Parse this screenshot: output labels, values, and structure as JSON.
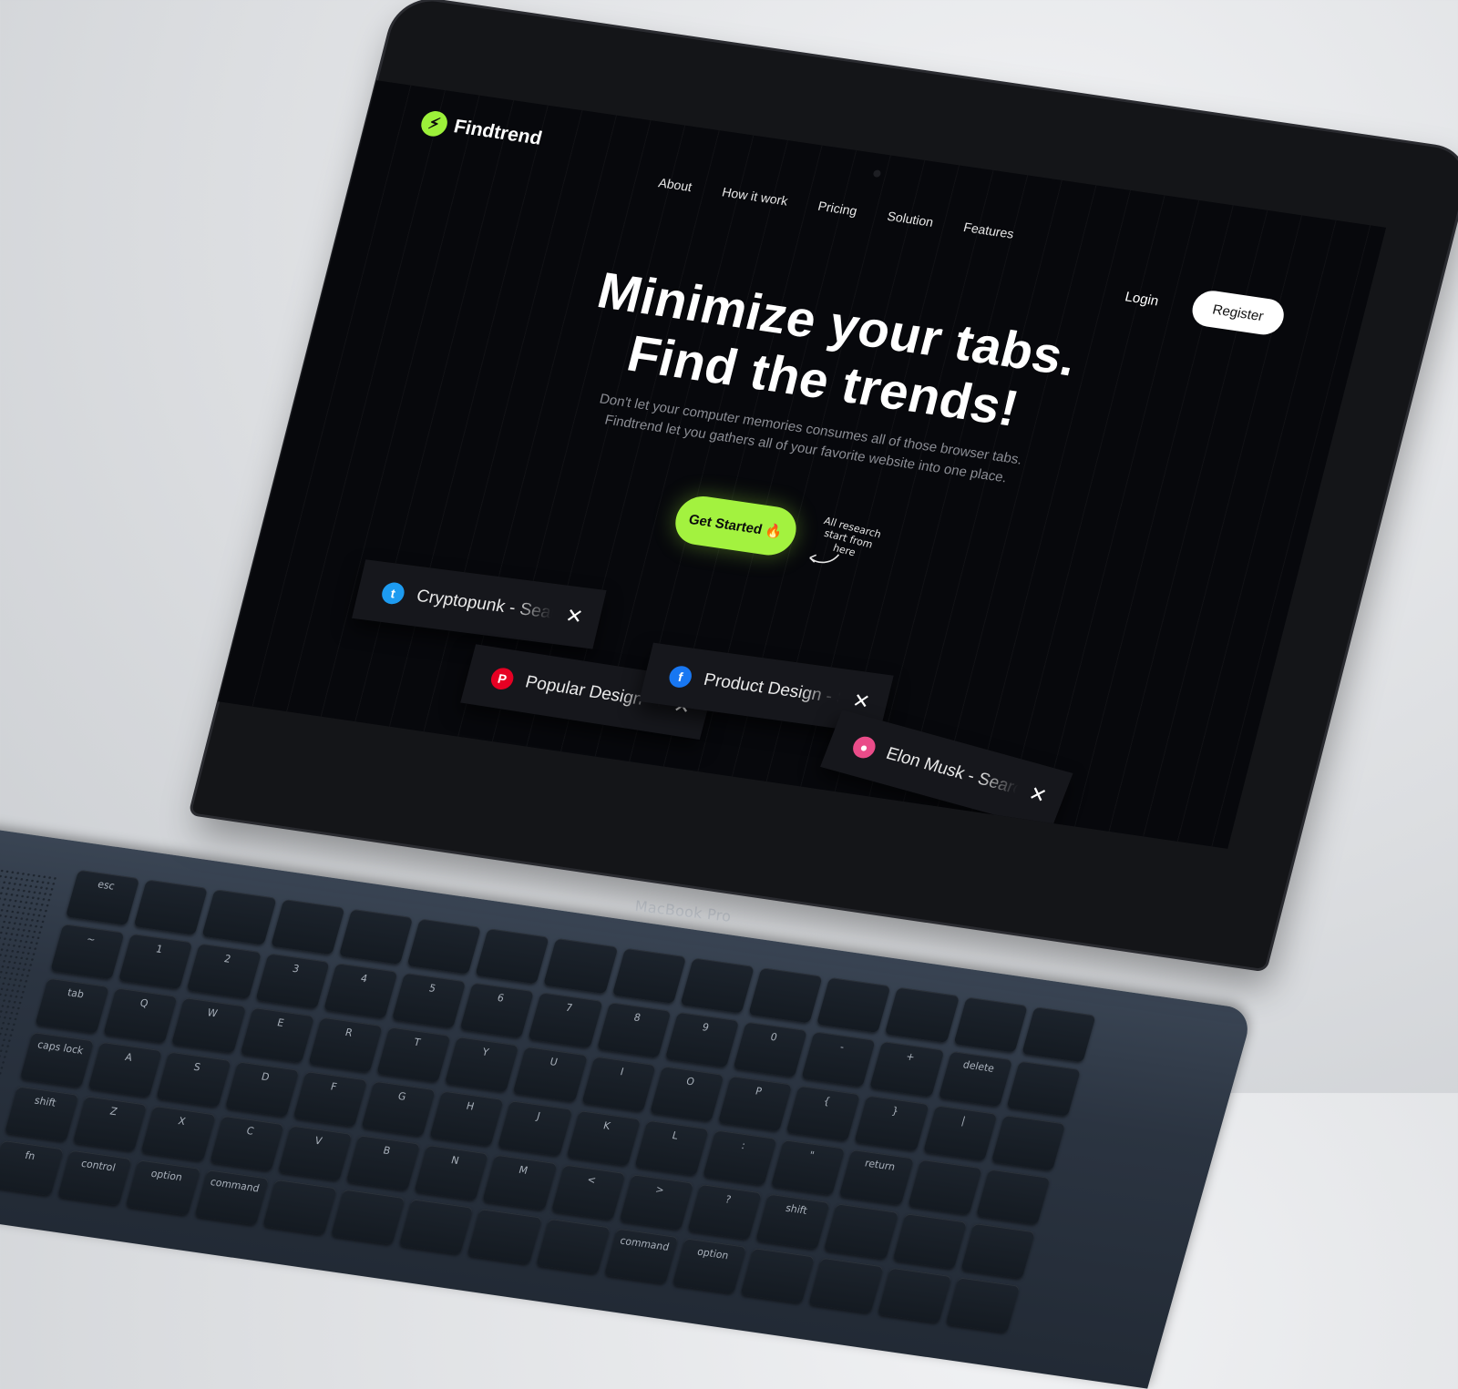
{
  "brand": {
    "name": "Findtrend",
    "logo_icon": "bolt-icon",
    "accent": "#9cf03a"
  },
  "nav": {
    "items": [
      {
        "label": "About"
      },
      {
        "label": "How it work"
      },
      {
        "label": "Pricing"
      },
      {
        "label": "Solution"
      },
      {
        "label": "Features"
      }
    ],
    "login_label": "Login",
    "register_label": "Register"
  },
  "hero": {
    "title_line1": "Minimize your tabs.",
    "title_line2": "Find the trends!",
    "subtitle_line1": "Don't let your computer memories consumes all of those browser tabs.",
    "subtitle_line2": "Findtrend  let you gathers all of your favorite website into one place.",
    "cta_label": "Get Started",
    "cta_emoji": "🔥",
    "hint_line1": "All research",
    "hint_line2": "start from here"
  },
  "tabs": [
    {
      "title": "Cryptopunk - Search",
      "icon": "twitter-icon",
      "icon_color": "#1d9bf0",
      "glyph": "t"
    },
    {
      "title": "Popular Design - Search",
      "icon": "pinterest-icon",
      "icon_color": "#e60023",
      "glyph": "P"
    },
    {
      "title": "Product Design - Search",
      "icon": "facebook-icon",
      "icon_color": "#1877f2",
      "glyph": "f"
    },
    {
      "title": "Elon Musk - Search",
      "icon": "dribbble-icon",
      "icon_color": "#ea4c89",
      "glyph": "●"
    }
  ],
  "device": {
    "label": "MacBook Pro"
  },
  "keyboard": {
    "keys": [
      "esc",
      "",
      "",
      "",
      "",
      "",
      "",
      "",
      "",
      "",
      "",
      "",
      "",
      "",
      "",
      "~",
      "1",
      "2",
      "3",
      "4",
      "5",
      "6",
      "7",
      "8",
      "9",
      "0",
      "-",
      "+",
      "delete",
      "",
      "tab",
      "Q",
      "W",
      "E",
      "R",
      "T",
      "Y",
      "U",
      "I",
      "O",
      "P",
      "{",
      "}",
      "|",
      "",
      "caps lock",
      "A",
      "S",
      "D",
      "F",
      "G",
      "H",
      "J",
      "K",
      "L",
      ":",
      "\"",
      "return",
      "",
      "",
      "shift",
      "Z",
      "X",
      "C",
      "V",
      "B",
      "N",
      "M",
      "<",
      ">",
      "?",
      "shift",
      "",
      "",
      "",
      "fn",
      "control",
      "option",
      "command",
      "",
      "",
      "",
      "",
      "",
      "command",
      "option",
      "",
      "",
      "",
      ""
    ]
  }
}
